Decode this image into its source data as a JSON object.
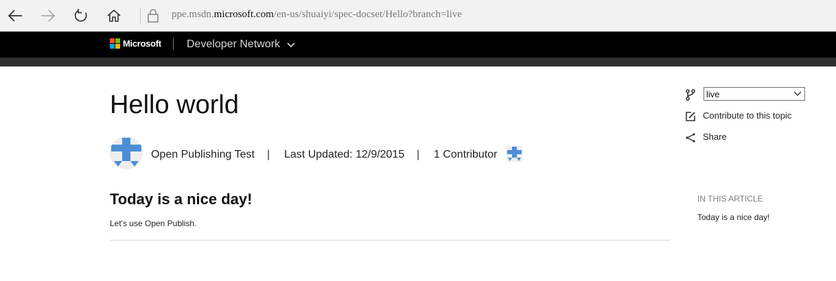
{
  "browser": {
    "url_prefix": "ppe.msdn.",
    "url_domain": "microsoft.com",
    "url_path": "/en-us/shuaiyi/spec-docset/Hello?branch=live",
    "icons": [
      "back-icon",
      "forward-icon",
      "refresh-icon",
      "home-icon",
      "lock-icon"
    ]
  },
  "header": {
    "brand": "Microsoft",
    "site": "Developer Network",
    "colors": {
      "background": "#000000",
      "subbar": "#2f2f2f",
      "logo": [
        "#f25022",
        "#7fba00",
        "#00a4ef",
        "#ffb900"
      ]
    }
  },
  "article": {
    "title": "Hello world",
    "author": "Open Publishing Test",
    "separator": "|",
    "last_updated": "Last Updated: 12/9/2015",
    "contributors": "1 Contributor",
    "heading": "Today is a nice day!",
    "body": "Let's use Open Publish."
  },
  "rail": {
    "branch_value": "live",
    "contribute": "Contribute to this topic",
    "share": "Share",
    "toc_heading": "IN THIS ARTICLE",
    "toc_items": [
      "Today is a nice day!"
    ]
  },
  "accent": "#4a8fd8"
}
